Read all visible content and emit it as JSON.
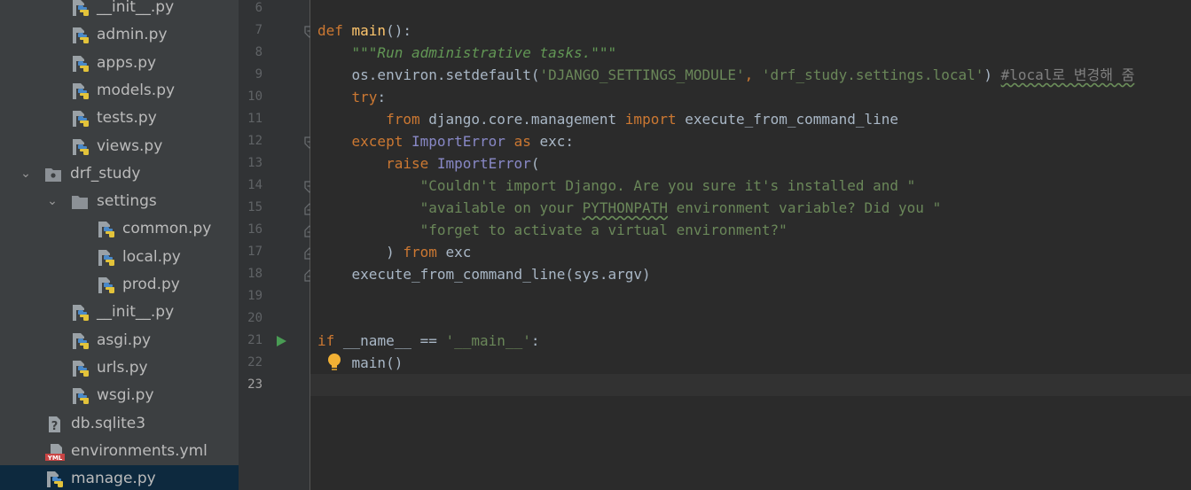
{
  "project_tree": {
    "items": [
      {
        "label": "__init__.py",
        "type": "python-file"
      },
      {
        "label": "admin.py",
        "type": "python-file"
      },
      {
        "label": "apps.py",
        "type": "python-file"
      },
      {
        "label": "models.py",
        "type": "python-file"
      },
      {
        "label": "tests.py",
        "type": "python-file"
      },
      {
        "label": "views.py",
        "type": "python-file"
      },
      {
        "label": "drf_study",
        "type": "package-folder",
        "expanded": true
      },
      {
        "label": "settings",
        "type": "folder",
        "expanded": true
      },
      {
        "label": "common.py",
        "type": "python-file"
      },
      {
        "label": "local.py",
        "type": "python-file"
      },
      {
        "label": "prod.py",
        "type": "python-file"
      },
      {
        "label": "__init__.py",
        "type": "python-file"
      },
      {
        "label": "asgi.py",
        "type": "python-file"
      },
      {
        "label": "urls.py",
        "type": "python-file"
      },
      {
        "label": "wsgi.py",
        "type": "python-file"
      },
      {
        "label": "db.sqlite3",
        "type": "unknown-file"
      },
      {
        "label": "environments.yml",
        "type": "yml-file"
      },
      {
        "label": "manage.py",
        "type": "python-file",
        "selected": true
      }
    ]
  },
  "editor": {
    "current_line": "23",
    "line_numbers": [
      "6",
      "7",
      "8",
      "9",
      "10",
      "11",
      "12",
      "13",
      "14",
      "15",
      "16",
      "17",
      "18",
      "19",
      "20",
      "21",
      "22",
      "23"
    ],
    "lines": [
      [],
      [
        {
          "t": "def ",
          "c": "kw"
        },
        {
          "t": "main",
          "c": "fn"
        },
        {
          "t": "():",
          "c": "plain"
        }
      ],
      [
        {
          "t": "    ",
          "c": "plain"
        },
        {
          "t": "\"\"\"Run administrative tasks.\"\"\"",
          "c": "doc"
        }
      ],
      [
        {
          "t": "    os.environ.setdefault(",
          "c": "plain"
        },
        {
          "t": "'DJANGO_SETTINGS_MODULE'",
          "c": "str"
        },
        {
          "t": ", ",
          "c": "kw"
        },
        {
          "t": "'drf_study.settings.local'",
          "c": "str"
        },
        {
          "t": ") ",
          "c": "plain"
        },
        {
          "t": "#local로 변경해 줌",
          "c": "cmt"
        }
      ],
      [
        {
          "t": "    ",
          "c": "plain"
        },
        {
          "t": "try",
          "c": "kw"
        },
        {
          "t": ":",
          "c": "plain"
        }
      ],
      [
        {
          "t": "        ",
          "c": "plain"
        },
        {
          "t": "from ",
          "c": "kw"
        },
        {
          "t": "django.core.management ",
          "c": "plain"
        },
        {
          "t": "import ",
          "c": "kw"
        },
        {
          "t": "execute_from_command_line",
          "c": "plain"
        }
      ],
      [
        {
          "t": "    ",
          "c": "plain"
        },
        {
          "t": "except ",
          "c": "kw"
        },
        {
          "t": "ImportError ",
          "c": "cls"
        },
        {
          "t": "as ",
          "c": "kw"
        },
        {
          "t": "exc:",
          "c": "plain"
        }
      ],
      [
        {
          "t": "        ",
          "c": "plain"
        },
        {
          "t": "raise ",
          "c": "kw"
        },
        {
          "t": "ImportError",
          "c": "cls"
        },
        {
          "t": "(",
          "c": "plain"
        }
      ],
      [
        {
          "t": "            ",
          "c": "plain"
        },
        {
          "t": "\"Couldn't import Django. Are you sure it's installed and \"",
          "c": "str"
        }
      ],
      [
        {
          "t": "            ",
          "c": "plain"
        },
        {
          "t": "\"available on your ",
          "c": "str"
        },
        {
          "t": "PYTHONPATH",
          "c": "str typo"
        },
        {
          "t": " environment variable? Did you \"",
          "c": "str"
        }
      ],
      [
        {
          "t": "            ",
          "c": "plain"
        },
        {
          "t": "\"forget to activate a virtual environment?\"",
          "c": "str"
        }
      ],
      [
        {
          "t": "        ) ",
          "c": "plain"
        },
        {
          "t": "from ",
          "c": "kw"
        },
        {
          "t": "exc",
          "c": "plain"
        }
      ],
      [
        {
          "t": "    execute_from_command_line(sys.argv)",
          "c": "plain"
        }
      ],
      [],
      [],
      [
        {
          "t": "if ",
          "c": "kw"
        },
        {
          "t": "__name__ == ",
          "c": "plain"
        },
        {
          "t": "'__main__'",
          "c": "str"
        },
        {
          "t": ":",
          "c": "plain"
        }
      ],
      [
        {
          "t": "    main()",
          "c": "plain"
        }
      ],
      []
    ]
  },
  "colors": {
    "tree_bg": "#3c3f41",
    "selected_bg": "#0d293e",
    "editor_bg": "#2b2b2b",
    "gutter_bg": "#313335",
    "keyword": "#cc7832",
    "function": "#ffc66d",
    "string": "#6a8759"
  }
}
